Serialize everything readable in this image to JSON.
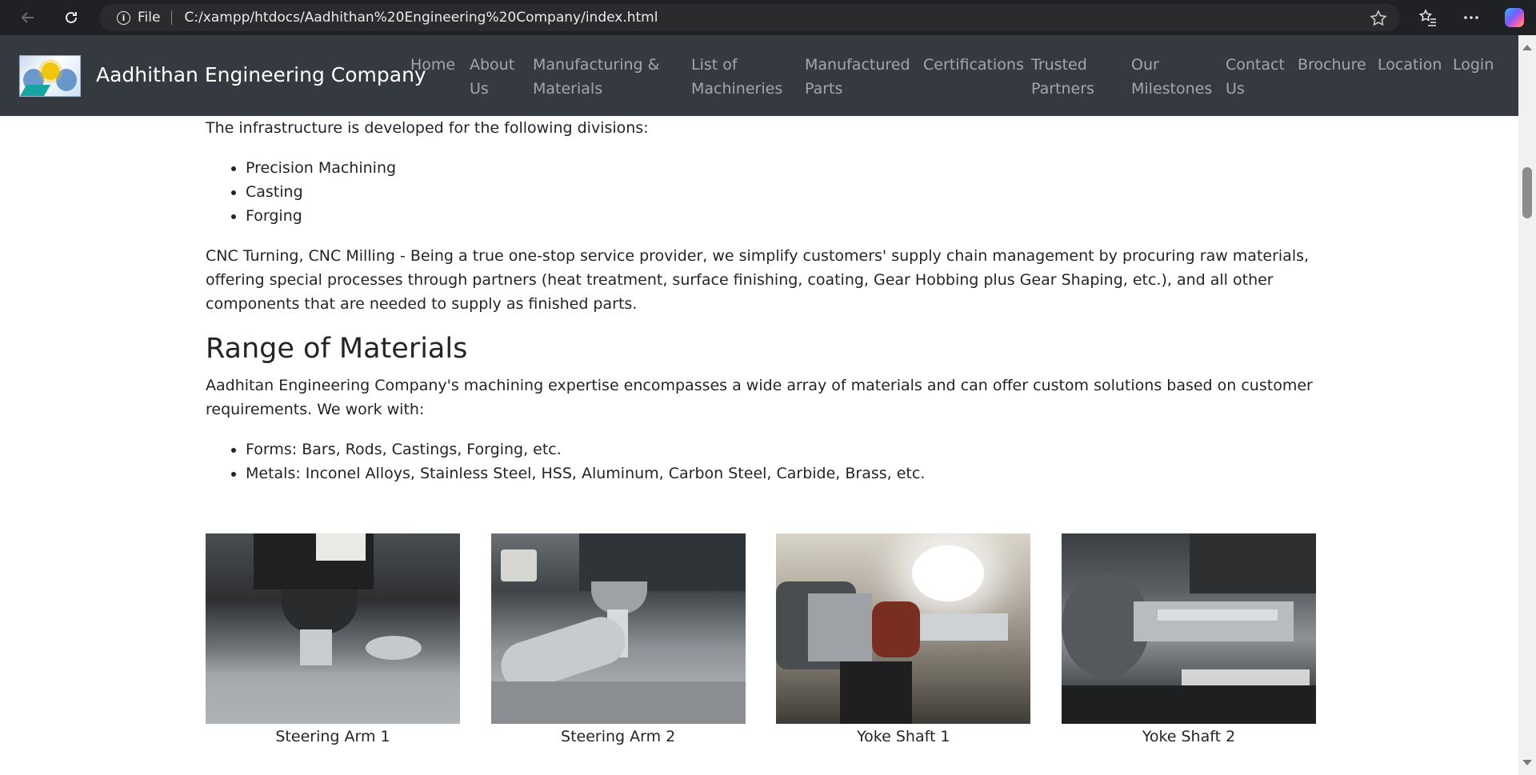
{
  "browser": {
    "file_label": "File",
    "url": "C:/xampp/htdocs/Aadhithan%20Engineering%20Company/index.html",
    "icons": [
      "back-arrow-icon",
      "reload-icon",
      "info-icon",
      "star-icon",
      "favorites-icon",
      "more-icon",
      "copilot-icon"
    ]
  },
  "navbar": {
    "brand": "Aadhithan Engineering Company",
    "links": [
      {
        "line1": "Home",
        "line2": ""
      },
      {
        "line1": "About",
        "line2": "Us"
      },
      {
        "line1": "Manufacturing &",
        "line2": "Materials"
      },
      {
        "line1": "List of",
        "line2": "Machineries"
      },
      {
        "line1": "Manufactured",
        "line2": "Parts"
      },
      {
        "line1": "Certifications",
        "line2": ""
      },
      {
        "line1": "Trusted",
        "line2": "Partners"
      },
      {
        "line1": "Our",
        "line2": "Milestones"
      },
      {
        "line1": "Contact",
        "line2": "Us"
      },
      {
        "line1": "Brochure",
        "line2": ""
      },
      {
        "line1": "Location",
        "line2": ""
      },
      {
        "line1": "Login",
        "line2": ""
      }
    ]
  },
  "content": {
    "intro": "The infrastructure is developed for the following divisions:",
    "divisions": [
      "Precision Machining",
      "Casting",
      "Forging"
    ],
    "cnc_paragraph": "CNC Turning, CNC Milling - Being a true one-stop service provider, we simplify customers' supply chain management by procuring raw materials, offering special processes through partners (heat treatment, surface finishing, coating, Gear Hobbing plus Gear Shaping, etc.), and all other components that are needed to supply as finished parts.",
    "materials_heading": "Range of Materials",
    "materials_paragraph": "Aadhitan Engineering Company's machining expertise encompasses a wide array of materials and can offer custom solutions based on customer requirements. We work with:",
    "materials": [
      "Forms: Bars, Rods, Castings, Forging, etc.",
      "Metals: Inconel Alloys, Stainless Steel, HSS, Aluminum, Carbon Steel, Carbide, Brass, etc."
    ]
  },
  "gallery": [
    {
      "caption": "Steering Arm 1"
    },
    {
      "caption": "Steering Arm 2"
    },
    {
      "caption": "Yoke Shaft 1"
    },
    {
      "caption": "Yoke Shaft 2"
    }
  ]
}
